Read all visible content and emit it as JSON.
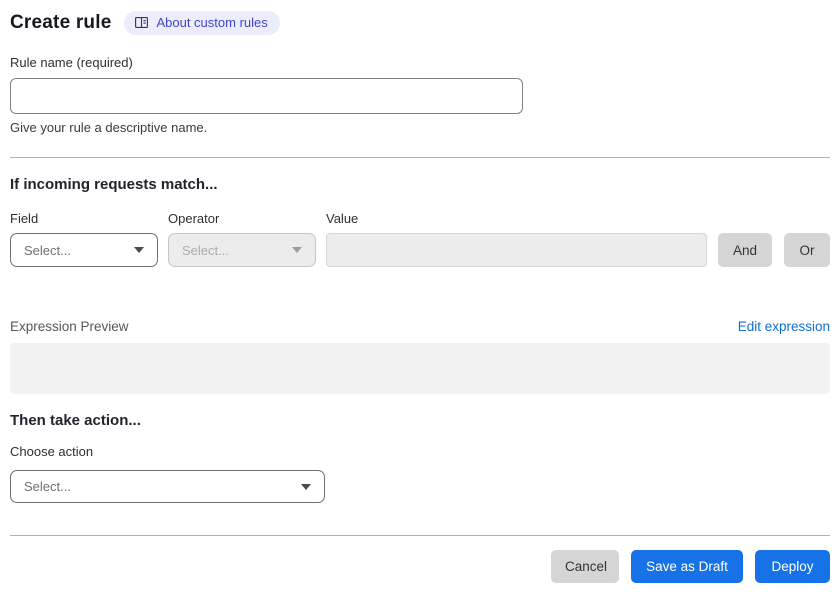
{
  "page": {
    "title": "Create rule"
  },
  "about_badge": {
    "label": "About custom rules",
    "icon": "book-icon"
  },
  "rule_name": {
    "label": "Rule name (required)",
    "value": "",
    "helper": "Give your rule a descriptive name."
  },
  "match_section": {
    "heading": "If incoming requests match...",
    "field": {
      "label": "Field",
      "selected": "Select..."
    },
    "operator": {
      "label": "Operator",
      "selected": "Select...",
      "disabled": true
    },
    "value": {
      "label": "Value",
      "value": "",
      "disabled": true
    },
    "and_button": "And",
    "or_button": "Or",
    "expression_preview_label": "Expression Preview",
    "edit_expression_link": "Edit expression",
    "expression_value": ""
  },
  "action_section": {
    "heading": "Then take action...",
    "choose_action_label": "Choose action",
    "action_select": {
      "selected": "Select..."
    }
  },
  "footer": {
    "cancel": "Cancel",
    "save_draft": "Save as Draft",
    "deploy": "Deploy"
  },
  "colors": {
    "primary_blue": "#1672e6",
    "link_blue": "#0f6cd8",
    "badge_bg": "#ecedfb",
    "badge_text": "#4245cb",
    "disabled_bg": "#ececec",
    "neutral_button_bg": "#d5d5d5",
    "preview_box_bg": "#f2f2f2",
    "divider": "#b2b2b2"
  }
}
